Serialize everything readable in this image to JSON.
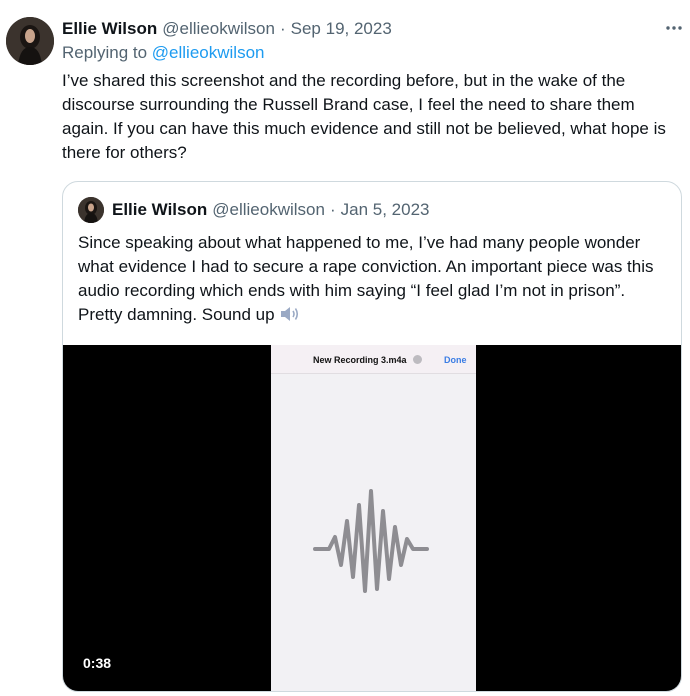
{
  "tweet": {
    "author_name": "Ellie Wilson",
    "author_handle": "@ellieokwilson",
    "separator": "·",
    "date": "Sep 19, 2023",
    "replying_prefix": "Replying to ",
    "replying_handle": "@ellieokwilson",
    "text": "I’ve shared this screenshot and the recording before, but in the wake of the discourse surrounding the Russell Brand case, I feel the need to share them again. If you can have this much evidence and still not be believed, what hope is there for others?",
    "more_icon": "more-horizontal-icon"
  },
  "quote": {
    "author_name": "Ellie Wilson",
    "author_handle": "@ellieokwilson",
    "separator": "·",
    "date": "Jan 5, 2023",
    "text": "Since speaking about what happened to me, I’ve had many people wonder what evidence I had to secure a rape conviction. An important piece was this audio recording which ends with him saying “I feel glad I’m not in prison”. Pretty damning. Sound up",
    "emoji_icon": "speaker-high-volume-icon"
  },
  "video": {
    "recording_title": "New Recording 3.m4a",
    "done_label": "Done",
    "duration": "0:38",
    "waveform_icon": "audio-waveform-icon"
  },
  "colors": {
    "link": "#1d9bf0",
    "secondary_text": "#536471",
    "border": "#cfd9de"
  }
}
